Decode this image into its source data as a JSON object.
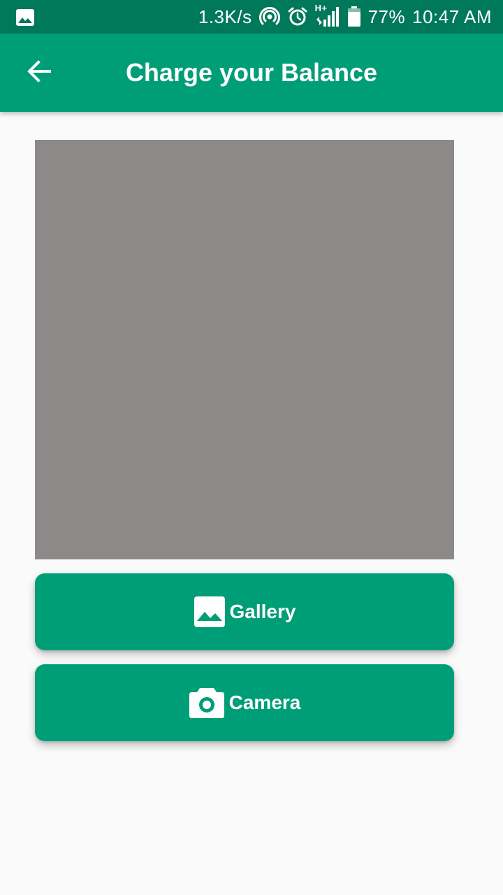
{
  "status_bar": {
    "network_speed": "1.3K/s",
    "network_type": "H+",
    "battery": "77%",
    "time": "10:47 AM",
    "icons": [
      "image-notification-icon",
      "hotspot-icon",
      "alarm-icon",
      "signal-icon",
      "battery-icon"
    ]
  },
  "app_bar": {
    "title": "Charge your Balance",
    "back_icon": "arrow-back-icon"
  },
  "image_preview": {
    "color": "#8d8988"
  },
  "buttons": {
    "gallery_label": "Gallery",
    "gallery_icon": "image-icon",
    "camera_label": "Camera",
    "camera_icon": "camera-icon"
  },
  "colors": {
    "primary": "#009e77",
    "status_bar": "#00785a",
    "background": "#fafafa"
  }
}
